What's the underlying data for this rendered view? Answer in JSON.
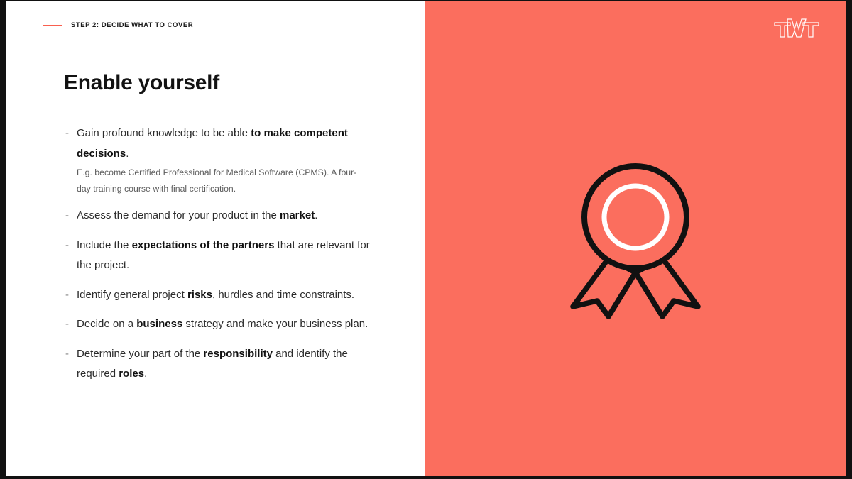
{
  "slide": {
    "eyebrow": "STEP 2: DECIDE WHAT TO COVER",
    "title": "Enable yourself",
    "bullet_marker": "-",
    "bullets": [
      {
        "prefix": "Gain profound knowledge to be able ",
        "bold": "to make competent decisions",
        "suffix": ".",
        "note": "E.g. become Certified Professional for Medical Software (CPMS). A four-day training course with final certification."
      },
      {
        "prefix": "Assess the demand for your product in the ",
        "bold": "market",
        "suffix": ".",
        "note": ""
      },
      {
        "prefix": "Include the ",
        "bold": "expectations of the partners",
        "suffix": " that are relevant for the project.",
        "note": ""
      },
      {
        "prefix": "Identify general project ",
        "bold": "risks",
        "suffix": ", hurdles and time constraints.",
        "note": ""
      },
      {
        "prefix": "Decide on a ",
        "bold": "business",
        "suffix": " strategy and make your business plan.",
        "note": ""
      },
      {
        "prefix": "Determine your part of the ",
        "bold": "responsibility",
        "suffix": " and identify the required ",
        "bold2": "roles",
        "suffix2": ".",
        "note": ""
      }
    ],
    "logo_text": "TWT",
    "artwork": "award-ribbon-badge",
    "colors": {
      "accent": "#fb6e5e",
      "rule": "#f9604f",
      "title": "#121212",
      "body": "#2b2b2b",
      "note": "#5d5d5d",
      "outline": "#111111",
      "panel": "#ffffff"
    }
  }
}
